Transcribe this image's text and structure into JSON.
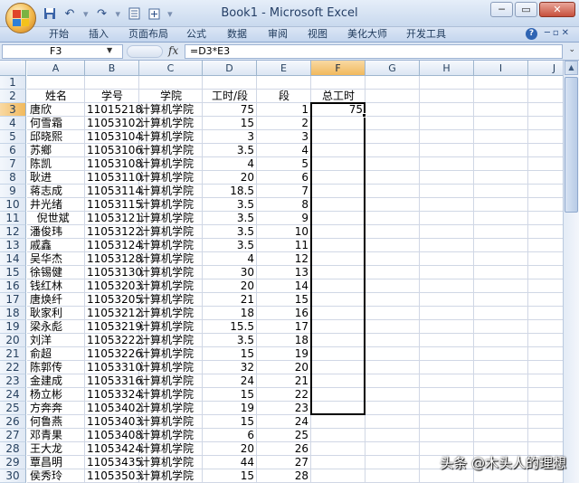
{
  "window": {
    "title": "Book1 - Microsoft Excel",
    "minimize": "─",
    "restore": "▭",
    "close": "✕"
  },
  "quick_access": [
    "save-icon",
    "undo-icon",
    "redo-icon",
    "print-preview-icon",
    "customize-icon"
  ],
  "ribbon_tabs": [
    "开始",
    "插入",
    "页面布局",
    "公式",
    "数据",
    "审阅",
    "视图",
    "美化大师",
    "开发工具"
  ],
  "formula_bar": {
    "name_box": "F3",
    "fx": "fx",
    "formula": "=D3*E3"
  },
  "columns": [
    "A",
    "B",
    "C",
    "D",
    "E",
    "F",
    "G",
    "H",
    "I",
    "J"
  ],
  "rows": [
    "1",
    "2",
    "3",
    "4",
    "5",
    "6",
    "7",
    "8",
    "9",
    "10",
    "11",
    "12",
    "13",
    "14",
    "15",
    "16",
    "17",
    "18",
    "19",
    "20",
    "21",
    "22",
    "23",
    "24",
    "25",
    "26",
    "27",
    "28",
    "29",
    "30"
  ],
  "headers": {
    "name": "姓名",
    "id": "学号",
    "college": "学院",
    "hours": "工时/段",
    "segment": "段",
    "total": "总工时"
  },
  "records": [
    {
      "name": "唐欣",
      "id": "11015218",
      "college": "计算机学院",
      "hours": "75",
      "seg": "1",
      "total": "75"
    },
    {
      "name": "何雪霜",
      "id": "11053102",
      "college": "计算机学院",
      "hours": "15",
      "seg": "2",
      "total": ""
    },
    {
      "name": "邱晓熙",
      "id": "11053104",
      "college": "计算机学院",
      "hours": "3",
      "seg": "3",
      "total": ""
    },
    {
      "name": "苏鄉",
      "id": "11053106",
      "college": "计算机学院",
      "hours": "3.5",
      "seg": "4",
      "total": ""
    },
    {
      "name": "陈凯",
      "id": "11053108",
      "college": "计算机学院",
      "hours": "4",
      "seg": "5",
      "total": ""
    },
    {
      "name": "耿进",
      "id": "11053110",
      "college": "计算机学院",
      "hours": "20",
      "seg": "6",
      "total": ""
    },
    {
      "name": "蒋志成",
      "id": "11053114",
      "college": "计算机学院",
      "hours": "18.5",
      "seg": "7",
      "total": ""
    },
    {
      "name": "井光绪",
      "id": "11053115",
      "college": "计算机学院",
      "hours": "3.5",
      "seg": "8",
      "total": ""
    },
    {
      "name": "  倪世斌",
      "id": "11053121",
      "college": "计算机学院",
      "hours": "3.5",
      "seg": "9",
      "total": ""
    },
    {
      "name": "潘俊玮",
      "id": "11053122",
      "college": "计算机学院",
      "hours": "3.5",
      "seg": "10",
      "total": ""
    },
    {
      "name": "戚鑫",
      "id": "11053124",
      "college": "计算机学院",
      "hours": "3.5",
      "seg": "11",
      "total": ""
    },
    {
      "name": "吴华杰",
      "id": "11053128",
      "college": "计算机学院",
      "hours": "4",
      "seg": "12",
      "total": ""
    },
    {
      "name": "徐锡健",
      "id": "11053130",
      "college": "计算机学院",
      "hours": "30",
      "seg": "13",
      "total": ""
    },
    {
      "name": "钱红林",
      "id": "11053203",
      "college": "计算机学院",
      "hours": "20",
      "seg": "14",
      "total": ""
    },
    {
      "name": "唐焕纤",
      "id": "11053205",
      "college": "计算机学院",
      "hours": "21",
      "seg": "15",
      "total": ""
    },
    {
      "name": "耿家利",
      "id": "11053212",
      "college": "计算机学院",
      "hours": "18",
      "seg": "16",
      "total": ""
    },
    {
      "name": "梁永彪",
      "id": "11053219",
      "college": "计算机学院",
      "hours": "15.5",
      "seg": "17",
      "total": ""
    },
    {
      "name": "刘洋",
      "id": "11053222",
      "college": "计算机学院",
      "hours": "3.5",
      "seg": "18",
      "total": ""
    },
    {
      "name": "俞超",
      "id": "11053226",
      "college": "计算机学院",
      "hours": "15",
      "seg": "19",
      "total": ""
    },
    {
      "name": "陈郭传",
      "id": "11053310",
      "college": "计算机学院",
      "hours": "32",
      "seg": "20",
      "total": ""
    },
    {
      "name": "金建成",
      "id": "11053316",
      "college": "计算机学院",
      "hours": "24",
      "seg": "21",
      "total": ""
    },
    {
      "name": "杨立彬",
      "id": "11053324",
      "college": "计算机学院",
      "hours": "15",
      "seg": "22",
      "total": ""
    },
    {
      "name": "方奔奔",
      "id": "11053402",
      "college": "计算机学院",
      "hours": "19",
      "seg": "23",
      "total": ""
    },
    {
      "name": "何鲁燕",
      "id": "11053403",
      "college": "计算机学院",
      "hours": "15",
      "seg": "24",
      "total": ""
    },
    {
      "name": "邓青果",
      "id": "11053408",
      "college": "计算机学院",
      "hours": "6",
      "seg": "25",
      "total": ""
    },
    {
      "name": "王大龙",
      "id": "11053424",
      "college": "计算机学院",
      "hours": "20",
      "seg": "26",
      "total": ""
    },
    {
      "name": "覃昌明",
      "id": "11053435",
      "college": "计算机学院",
      "hours": "44",
      "seg": "27",
      "total": ""
    },
    {
      "name": "侯秀玲",
      "id": "11053503",
      "college": "计算机学院",
      "hours": "15",
      "seg": "28",
      "total": ""
    }
  ],
  "watermark": "头条 @木头人的理想"
}
